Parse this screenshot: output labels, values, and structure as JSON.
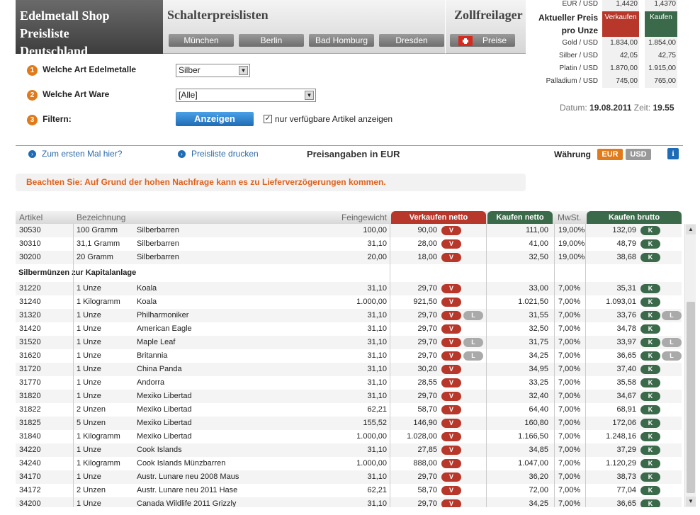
{
  "header": {
    "brand_line1": "Edelmetall Shop Preisliste",
    "brand_line2": "Deutschland",
    "schalter_title": "Schalterpreislisten",
    "zoll_title": "Zollfreilager",
    "cities": [
      "München",
      "Berlin",
      "Bad Homburg",
      "Dresden"
    ],
    "preise_label": "Preise"
  },
  "pricebox": {
    "eur_usd_label": "EUR / USD",
    "eur_usd_sell": "1,4420",
    "eur_usd_buy": "1,4370",
    "title": "Aktueller Preis pro Unze",
    "sell_head": "Verkaufen",
    "buy_head": "Kaufen",
    "rows": [
      {
        "label": "Gold / USD",
        "sell": "1.834,00",
        "buy": "1.854,00"
      },
      {
        "label": "Silber / USD",
        "sell": "42,05",
        "buy": "42,75"
      },
      {
        "label": "Platin / USD",
        "sell": "1.870,00",
        "buy": "1.915,00"
      },
      {
        "label": "Palladium / USD",
        "sell": "745,00",
        "buy": "765,00"
      }
    ],
    "date_label": "Datum:",
    "date": "19.08.2011",
    "time_label": "Zeit:",
    "time": "19.55"
  },
  "form": {
    "step1_label": "Welche Art Edelmetalle",
    "step1_value": "Silber",
    "step2_label": "Welche Art Ware",
    "step2_value": "[Alle]",
    "step3_label": "Filtern:",
    "show_button": "Anzeigen",
    "checkbox_label": "nur verfügbare Artikel anzeigen",
    "checkbox_mark": "✓"
  },
  "toolbar": {
    "first_time_link": "Zum ersten Mal hier?",
    "print_link": "Preisliste drucken",
    "price_info": "Preisangaben in EUR",
    "currency_label": "Währung",
    "eur": "EUR",
    "usd": "USD",
    "info": "i"
  },
  "notice": "Beachten Sie: Auf Grund der hohen Nachfrage kann es zu Lieferverzögerungen kommen.",
  "table": {
    "headers": {
      "artikel": "Artikel",
      "bezeichnung": "Bezeichnung",
      "feingewicht": "Feingewicht",
      "verkaufen": "Verkaufen netto",
      "kaufen": "Kaufen netto",
      "mwst": "MwSt.",
      "kaufen_brutto": "Kaufen brutto"
    },
    "v_label": "V",
    "k_label": "K",
    "l_label": "L",
    "section_title": "Silbermünzen zur Kapitalanlage",
    "rows_top": [
      {
        "art": "30530",
        "w": "100 Gramm",
        "name": "Silberbarren",
        "fg": "100,00",
        "sell": "90,00",
        "buy": "111,00",
        "mwst": "19,00%",
        "bb": "132,09",
        "l": false
      },
      {
        "art": "30310",
        "w": "31,1 Gramm",
        "name": "Silberbarren",
        "fg": "31,10",
        "sell": "28,00",
        "buy": "41,00",
        "mwst": "19,00%",
        "bb": "48,79",
        "l": false
      },
      {
        "art": "30200",
        "w": "20 Gramm",
        "name": "Silberbarren",
        "fg": "20,00",
        "sell": "18,00",
        "buy": "32,50",
        "mwst": "19,00%",
        "bb": "38,68",
        "l": false
      }
    ],
    "rows": [
      {
        "art": "31220",
        "w": "1 Unze",
        "name": "Koala",
        "fg": "31,10",
        "sell": "29,70",
        "buy": "33,00",
        "mwst": "7,00%",
        "bb": "35,31",
        "l": false
      },
      {
        "art": "31240",
        "w": "1 Kilogramm",
        "name": "Koala",
        "fg": "1.000,00",
        "sell": "921,50",
        "buy": "1.021,50",
        "mwst": "7,00%",
        "bb": "1.093,01",
        "l": false
      },
      {
        "art": "31320",
        "w": "1 Unze",
        "name": "Philharmoniker",
        "fg": "31,10",
        "sell": "29,70",
        "buy": "31,55",
        "mwst": "7,00%",
        "bb": "33,76",
        "l": true
      },
      {
        "art": "31420",
        "w": "1 Unze",
        "name": "American Eagle",
        "fg": "31,10",
        "sell": "29,70",
        "buy": "32,50",
        "mwst": "7,00%",
        "bb": "34,78",
        "l": false
      },
      {
        "art": "31520",
        "w": "1 Unze",
        "name": "Maple Leaf",
        "fg": "31,10",
        "sell": "29,70",
        "buy": "31,75",
        "mwst": "7,00%",
        "bb": "33,97",
        "l": true
      },
      {
        "art": "31620",
        "w": "1 Unze",
        "name": "Britannia",
        "fg": "31,10",
        "sell": "29,70",
        "buy": "34,25",
        "mwst": "7,00%",
        "bb": "36,65",
        "l": true
      },
      {
        "art": "31720",
        "w": "1 Unze",
        "name": "China Panda",
        "fg": "31,10",
        "sell": "30,20",
        "buy": "34,95",
        "mwst": "7,00%",
        "bb": "37,40",
        "l": false
      },
      {
        "art": "31770",
        "w": "1 Unze",
        "name": "Andorra",
        "fg": "31,10",
        "sell": "28,55",
        "buy": "33,25",
        "mwst": "7,00%",
        "bb": "35,58",
        "l": false
      },
      {
        "art": "31820",
        "w": "1 Unze",
        "name": "Mexiko Libertad",
        "fg": "31,10",
        "sell": "29,70",
        "buy": "32,40",
        "mwst": "7,00%",
        "bb": "34,67",
        "l": false
      },
      {
        "art": "31822",
        "w": "2 Unzen",
        "name": "Mexiko Libertad",
        "fg": "62,21",
        "sell": "58,70",
        "buy": "64,40",
        "mwst": "7,00%",
        "bb": "68,91",
        "l": false
      },
      {
        "art": "31825",
        "w": "5 Unzen",
        "name": "Mexiko Libertad",
        "fg": "155,52",
        "sell": "146,90",
        "buy": "160,80",
        "mwst": "7,00%",
        "bb": "172,06",
        "l": false
      },
      {
        "art": "31840",
        "w": "1 Kilogramm",
        "name": "Mexiko Libertad",
        "fg": "1.000,00",
        "sell": "1.028,00",
        "buy": "1.166,50",
        "mwst": "7,00%",
        "bb": "1.248,16",
        "l": false
      },
      {
        "art": "34220",
        "w": "1 Unze",
        "name": "Cook Islands",
        "fg": "31,10",
        "sell": "27,85",
        "buy": "34,85",
        "mwst": "7,00%",
        "bb": "37,29",
        "l": false
      },
      {
        "art": "34240",
        "w": "1 Kilogramm",
        "name": "Cook Islands Münzbarren",
        "fg": "1.000,00",
        "sell": "888,00",
        "buy": "1.047,00",
        "mwst": "7,00%",
        "bb": "1.120,29",
        "l": false
      },
      {
        "art": "34170",
        "w": "1 Unze",
        "name": "Austr. Lunare neu 2008 Maus",
        "fg": "31,10",
        "sell": "29,70",
        "buy": "36,20",
        "mwst": "7,00%",
        "bb": "38,73",
        "l": false
      },
      {
        "art": "34172",
        "w": "2 Unzen",
        "name": "Austr. Lunare neu 2011 Hase",
        "fg": "62,21",
        "sell": "58,70",
        "buy": "72,00",
        "mwst": "7,00%",
        "bb": "77,04",
        "l": false
      },
      {
        "art": "34200",
        "w": "1 Unze",
        "name": "Canada Wildlife 2011 Grizzly",
        "fg": "31,10",
        "sell": "29,70",
        "buy": "34,25",
        "mwst": "7,00%",
        "bb": "36,65",
        "l": false
      }
    ]
  }
}
